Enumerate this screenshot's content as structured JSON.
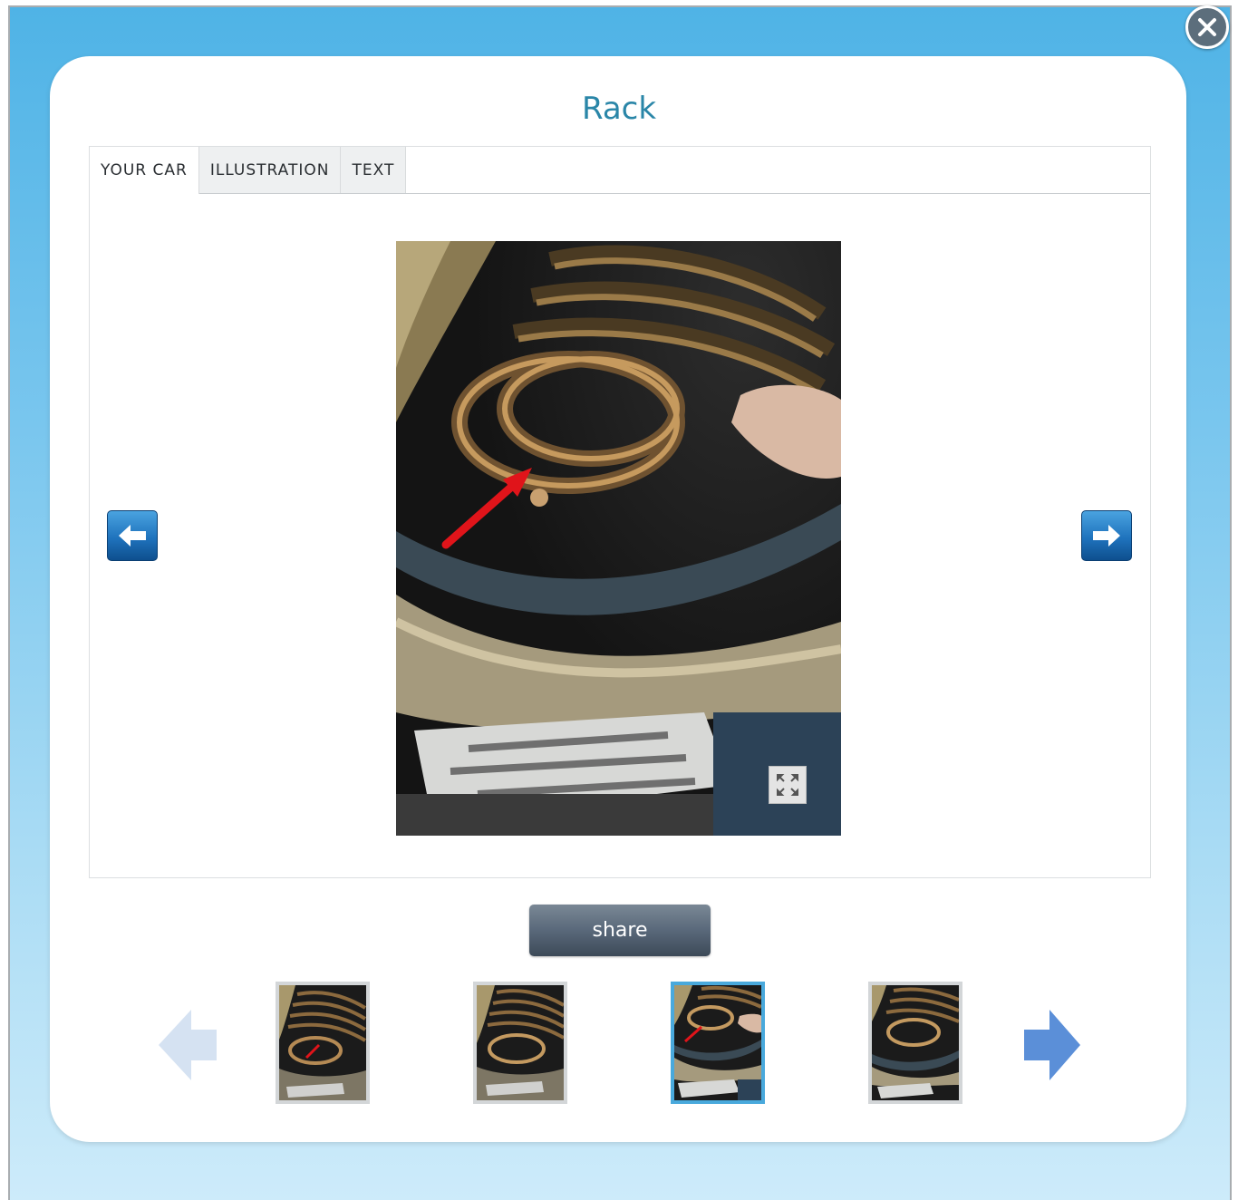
{
  "dialog": {
    "title": "Rack",
    "close_icon": "close-icon"
  },
  "tabs": [
    {
      "label": "YOUR CAR",
      "active": true
    },
    {
      "label": "ILLUSTRATION",
      "active": false
    },
    {
      "label": "TEXT",
      "active": false
    }
  ],
  "viewer": {
    "prev_icon": "arrow-left-icon",
    "next_icon": "arrow-right-icon",
    "expand_icon": "expand-icon"
  },
  "share": {
    "label": "share"
  },
  "thumbnails": {
    "count": 4,
    "selected_index": 2,
    "prev_enabled": false,
    "next_enabled": true
  },
  "colors": {
    "title": "#2a86a8",
    "frame_top": "#4fb3e6",
    "frame_bottom": "#cdebfa",
    "nav_button": "#1f73bd",
    "selected_thumb_border": "#49a9dc",
    "share_button": "#59687a"
  }
}
